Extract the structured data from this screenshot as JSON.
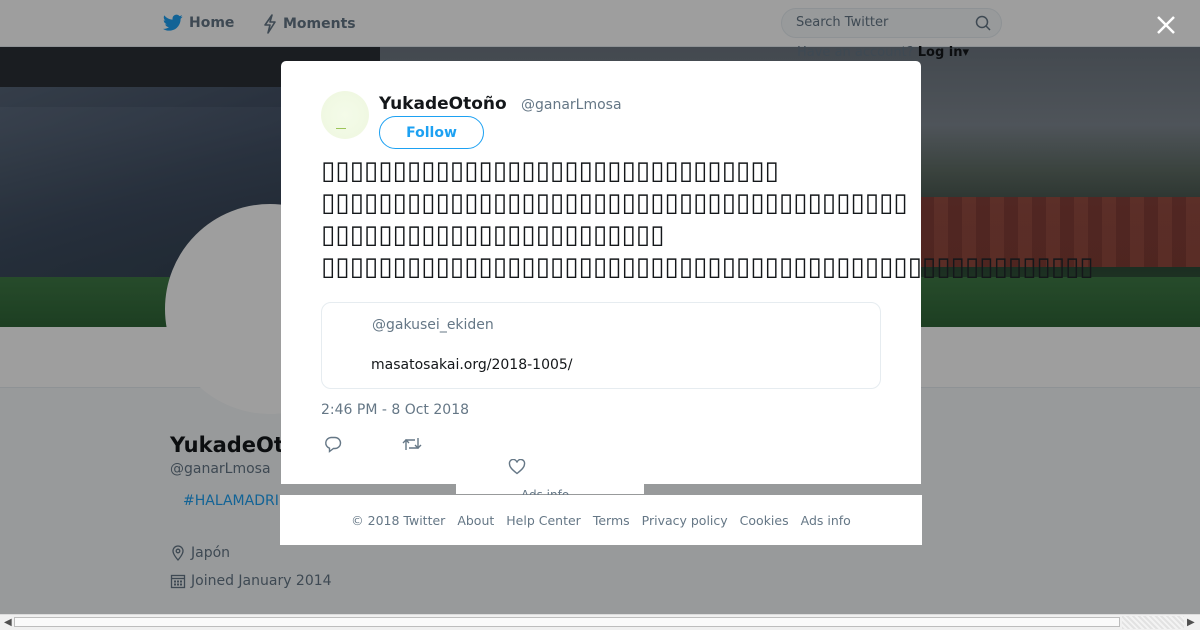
{
  "nav": {
    "home_label": "Home",
    "moments_label": "Moments",
    "search_placeholder": "Search Twitter",
    "have_account_text": "Have an account?",
    "login_label": "Log in"
  },
  "profile": {
    "name": "YukadeOto",
    "handle": "@ganarLmosa",
    "hashtag": "#HALAMADRI",
    "location": "Japón",
    "joined": "Joined January 2014"
  },
  "tweet": {
    "author_name": "YukadeOtoño",
    "author_handle": "@ganarLmosa",
    "follow_label": "Follow",
    "text_lines": [
      "▯▯▯▯▯▯▯▯▯▯▯▯▯▯▯▯▯▯▯▯▯▯▯▯▯▯▯▯▯▯▯▯",
      "▯▯▯▯▯▯▯▯▯▯▯▯▯▯▯▯▯▯▯▯▯▯▯▯▯▯▯▯▯▯▯▯▯▯▯▯▯▯▯▯▯",
      "▯▯▯▯▯▯▯▯▯▯▯▯▯▯▯▯▯▯▯▯▯▯▯▯",
      "▯▯▯▯▯▯▯▯▯▯▯▯▯▯▯▯▯▯▯▯▯▯▯▯▯▯▯▯▯▯▯▯▯▯▯▯▯▯▯▯▯▯▯▯▯▯▯▯▯▯▯▯▯▯"
    ],
    "quote_handle": "@gakusei_ekiden",
    "quote_link": "masatosakai.org/2018-1005/",
    "timestamp": "2:46 PM - 8 Oct 2018"
  },
  "background_fragments": {
    "ads_info": "Ads info"
  },
  "footer": {
    "copyright": "© 2018 Twitter",
    "about": "About",
    "help_center": "Help Center",
    "terms": "Terms",
    "privacy_policy": "Privacy policy",
    "cookies": "Cookies",
    "ads_info": "Ads info"
  },
  "colors": {
    "accent": "#1da1f2",
    "secondary_text": "#657786",
    "overlay": "rgba(0,0,0,0.38)"
  },
  "icons": [
    "twitter-bird-icon",
    "lightning-icon",
    "search-icon",
    "caret-down-icon",
    "close-icon",
    "location-pin-icon",
    "calendar-icon",
    "reply-icon",
    "retweet-icon",
    "heart-icon"
  ]
}
